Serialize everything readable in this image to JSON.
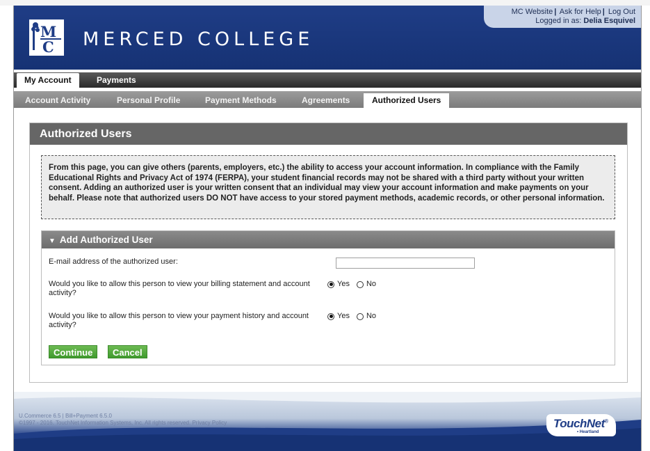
{
  "header": {
    "college_name": "MERCED COLLEGE",
    "logo_letters": "MC",
    "links": [
      "MC Website",
      "Ask for Help",
      "Log Out"
    ],
    "logged_in_label": "Logged in as:",
    "logged_in_user": "Delia Esquivel"
  },
  "nav_primary": [
    {
      "label": "My Account",
      "active": true
    },
    {
      "label": "Payments",
      "active": false
    }
  ],
  "nav_secondary": [
    {
      "label": "Account Activity",
      "active": false
    },
    {
      "label": "Personal Profile",
      "active": false
    },
    {
      "label": "Payment Methods",
      "active": false
    },
    {
      "label": "Agreements",
      "active": false
    },
    {
      "label": "Authorized Users",
      "active": true
    }
  ],
  "page": {
    "title": "Authorized Users",
    "notice": "From this page, you can give others (parents, employers, etc.) the ability to access your account information. In compliance with the Family Educational Rights and Privacy Act of 1974 (FERPA), your student financial records may not be shared with a third party without your written consent. Adding an authorized user is your written consent that an individual may view your account information and make payments on your behalf. Please note that authorized users DO NOT have access to your stored payment methods, academic records, or other personal information."
  },
  "add_user": {
    "section_title": "Add Authorized User",
    "email_label": "E-mail address of the authorized user:",
    "email_value": "",
    "q_billing": "Would you like to allow this person to view your billing statement and account activity?",
    "q_payment": "Would you like to allow this person to view your payment history and account activity?",
    "yes_label": "Yes",
    "no_label": "No",
    "billing_selected": "Yes",
    "payment_selected": "Yes",
    "continue_label": "Continue",
    "cancel_label": "Cancel"
  },
  "footer": {
    "version_line": "U.Commerce 6.5 | Bill+Payment 6.5.0",
    "copyright_line": "©1997 - 2016. TouchNet Information Systems, Inc. All rights reserved.",
    "privacy_link": "Privacy Policy",
    "brand_touch": "Touch",
    "brand_net": "Net",
    "brand_sub": "• Heartland"
  },
  "colors": {
    "header_blue": "#1f3d86",
    "button_green": "#4caa38",
    "panel_title_gray": "#666666"
  }
}
